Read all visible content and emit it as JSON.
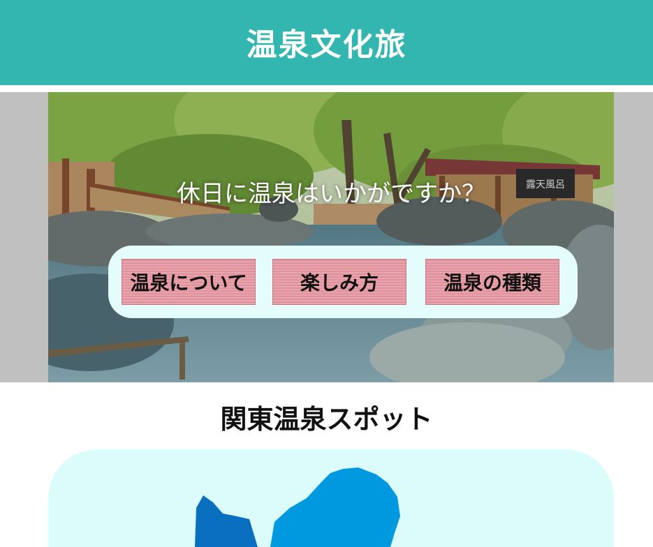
{
  "header": {
    "title": "温泉文化旅"
  },
  "hero": {
    "tagline": "休日に温泉はいかがですか？",
    "sign_text": "露天風呂",
    "nav": [
      {
        "label": "温泉について"
      },
      {
        "label": "楽しみ方"
      },
      {
        "label": "温泉の種類"
      }
    ]
  },
  "spots": {
    "title": "関東温泉スポット"
  },
  "colors": {
    "header_bg": "#33b6b0",
    "nav_button": "#e59aa4",
    "panel_bg": "#e4fcfc",
    "map_region": "#0099e0",
    "map_region_dark": "#0b6fbf"
  }
}
